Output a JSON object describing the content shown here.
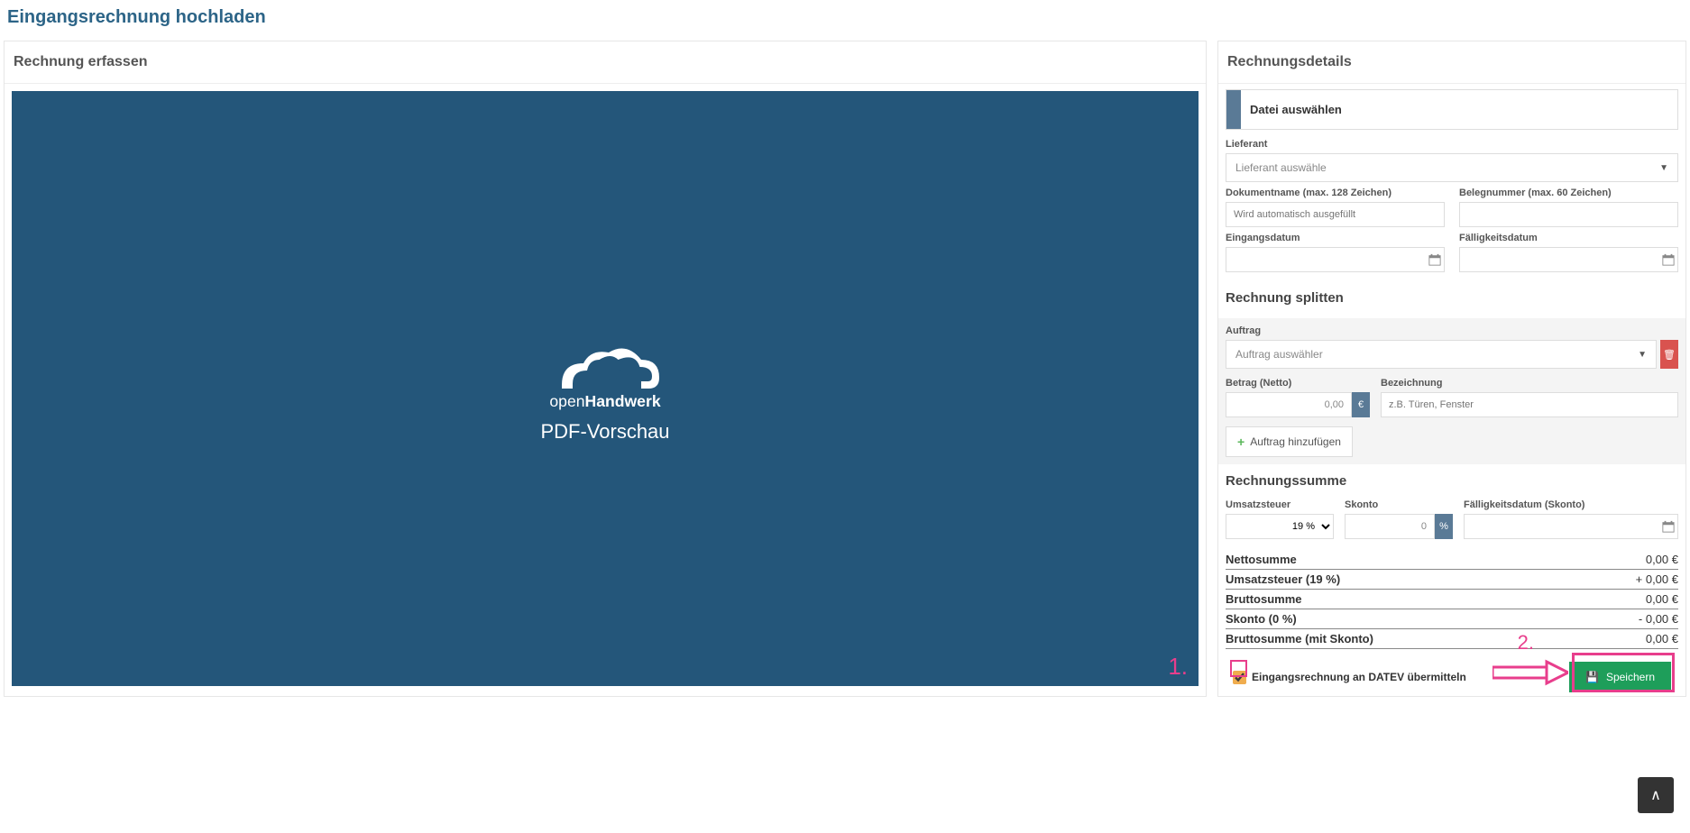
{
  "page_title": "Eingangsrechnung hochladen",
  "left": {
    "header": "Rechnung erfassen",
    "logo_brand_open": "open",
    "logo_brand_hand": "Handwerk",
    "preview_caption": "PDF-Vorschau",
    "annotation_1": "1."
  },
  "right": {
    "header": "Rechnungsdetails",
    "file_select": "Datei auswählen",
    "lieferant_label": "Lieferant",
    "lieferant_placeholder": "Lieferant auswähle",
    "dokumentname_label": "Dokumentname (max. 128 Zeichen)",
    "dokumentname_placeholder": "Wird automatisch ausgefüllt",
    "belegnummer_label": "Belegnummer (max. 60 Zeichen)",
    "eingangsdatum_label": "Eingangsdatum",
    "faelligkeitsdatum_label": "Fälligkeitsdatum",
    "splitten_title": "Rechnung splitten",
    "auftrag_label": "Auftrag",
    "auftrag_placeholder": "Auftrag auswähler",
    "betrag_label": "Betrag (Netto)",
    "betrag_value": "0,00",
    "betrag_unit": "€",
    "bezeichnung_label": "Bezeichnung",
    "bezeichnung_placeholder": "z.B. Türen, Fenster",
    "add_auftrag": "Auftrag hinzufügen",
    "summe_title": "Rechnungssumme",
    "umsatzsteuer_label": "Umsatzsteuer",
    "umsatzsteuer_value": "19 %",
    "skonto_label": "Skonto",
    "skonto_value": "0",
    "skonto_unit": "%",
    "faellig_skonto_label": "Fälligkeitsdatum (Skonto)",
    "lines": [
      {
        "label": "Nettosumme",
        "value": "0,00 €"
      },
      {
        "label": "Umsatzsteuer (19 %)",
        "value": "+ 0,00 €"
      },
      {
        "label": "Bruttosumme",
        "value": "0,00 €"
      },
      {
        "label": "Skonto (0 %)",
        "value": "- 0,00 €"
      },
      {
        "label": "Bruttosumme (mit Skonto)",
        "value": "0,00 €"
      }
    ],
    "datev_label": "Eingangsrechnung an DATEV übermitteln",
    "save_label": "Speichern",
    "annotation_2": "2."
  }
}
